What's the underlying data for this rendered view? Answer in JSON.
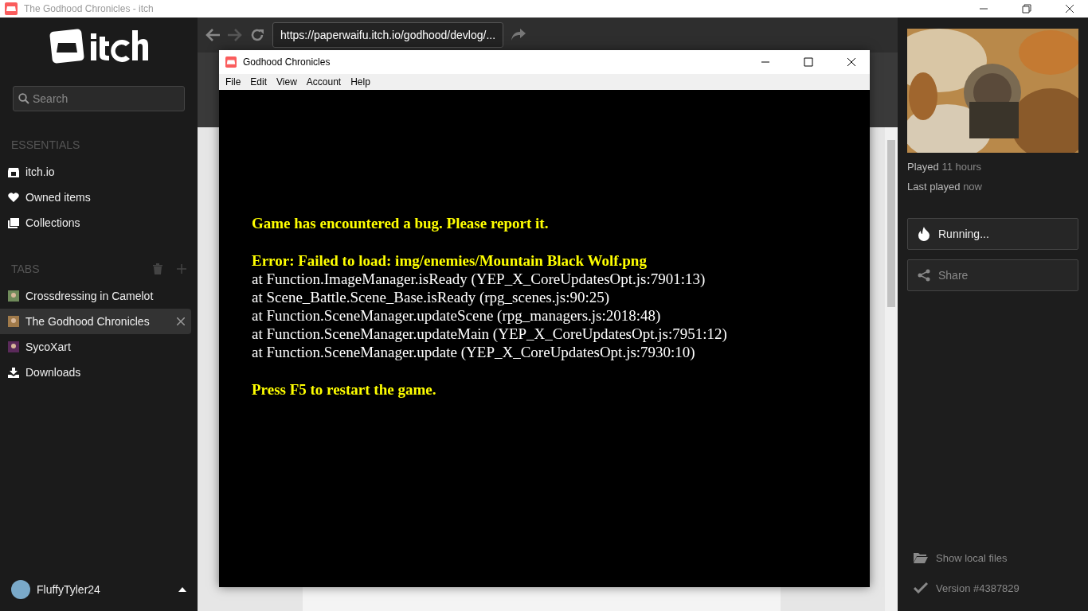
{
  "window": {
    "title": "The Godhood Chronicles - itch"
  },
  "sidebar": {
    "search": {
      "placeholder": "Search"
    },
    "essentials_header": "ESSENTIALS",
    "essentials": [
      {
        "label": "itch.io",
        "kind": "store"
      },
      {
        "label": "Owned items",
        "kind": "heart"
      },
      {
        "label": "Collections",
        "kind": "collection"
      }
    ],
    "tabs_header": "TABS",
    "tabs": [
      {
        "label": "Crossdressing in Camelot",
        "kind": "game",
        "selected": false
      },
      {
        "label": "The Godhood Chronicles",
        "kind": "game",
        "selected": true
      },
      {
        "label": "SycoXart",
        "kind": "game",
        "selected": false
      },
      {
        "label": "Downloads",
        "kind": "download",
        "selected": false
      }
    ],
    "user": {
      "name": "FluffyTyler24"
    }
  },
  "browser": {
    "url": "https://paperwaifu.itch.io/godhood/devlog/..."
  },
  "game_window": {
    "title": "Godhood Chronicles",
    "menu": [
      "File",
      "Edit",
      "View",
      "Account",
      "Help"
    ],
    "paragraphs": [
      {
        "lines": [
          {
            "kind": "alert",
            "text": "Game has encountered a bug. Please report it."
          }
        ]
      },
      {
        "lines": [
          {
            "kind": "alert",
            "text": "Error: Failed to load: img/enemies/Mountain Black Wolf.png"
          },
          {
            "kind": "trace",
            "text": "at Function.ImageManager.isReady (YEP_X_CoreUpdatesOpt.js:7901:13)"
          },
          {
            "kind": "trace",
            "text": "at Scene_Battle.Scene_Base.isReady (rpg_scenes.js:90:25)"
          },
          {
            "kind": "trace",
            "text": "at Function.SceneManager.updateScene (rpg_managers.js:2018:48)"
          },
          {
            "kind": "trace",
            "text": "at Function.SceneManager.updateMain (YEP_X_CoreUpdatesOpt.js:7951:12)"
          },
          {
            "kind": "trace",
            "text": "at Function.SceneManager.update (YEP_X_CoreUpdatesOpt.js:7930:10)"
          }
        ]
      },
      {
        "lines": [
          {
            "kind": "alert",
            "text": "Press F5 to restart the game."
          }
        ]
      }
    ]
  },
  "game_panel": {
    "stats": [
      {
        "label": "Played",
        "value": "11 hours"
      },
      {
        "label": "Last played",
        "value": "now"
      }
    ],
    "actions": [
      {
        "label": "Running...",
        "kind": "running"
      },
      {
        "label": "Share",
        "kind": "share"
      }
    ],
    "footer": [
      {
        "label": "Show local files",
        "kind": "folder"
      },
      {
        "label": "Version #4387829",
        "kind": "check"
      }
    ]
  }
}
